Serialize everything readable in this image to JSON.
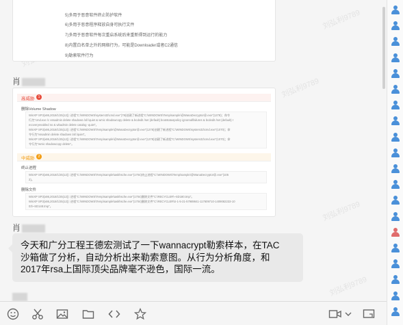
{
  "card1_steps": [
    "5)多用于恶意软件终止防护软件",
    "6)多用于恶意程序释放自身可执行文件",
    "7)多用于恶意软件每次重启系统后来重新得到运行的能力",
    "8)内置白名单之外的网络行为，可能是Downloader或者C2通信",
    "9)勒索软件行为"
  ],
  "message2": {
    "sender_name": "肖",
    "report": {
      "high": {
        "label": "高威胁",
        "count": "1",
        "category": "删除Volume Shadow",
        "details": [
          "WinXP SP3(x86,2018/1/25(12)): 进程\"C:\\WINDOWS\\system32\\cmd.exe\"(79)创建了新进程\"C:\\WINDOWS\\Temp\\sample\\@WanaDecryptor@.exe\"(1278)；命令",
          "行为\"cmd.exe /c vssadmin delete shadows /all /quiet & wmic shadowcopy delete & bcdedit /set {default} bootstatuspolicy ignoreallfailures & bcdedit /set {default} r",
          "ecoveryenabled no & wbadmin delete catalog -quiet\"。",
          "WinXP SP3(x86,2018/1/25(12)): 进程\"C:\\WINDOWS\\Temp\\sample\\@WanaDecryptor@.exe\"(1278)创建了新进程\"C:\\WINDOWS\\system32\\cmd.exe\"(1070)；命",
          "令行为\"vssadmin delete shadows /all /quiet\"。",
          "WinXP SP3(x86,2018/1/25(12)): 进程\"C:\\WINDOWS\\Temp\\sample\\@WanaDecryptor@.exe\"(1278)创建了新进程\"C:\\WINDOWS\\system32\\cmd.exe\"(1070)；命",
          "令行为\"wmic shadowcopy delete\"。"
        ]
      },
      "medium": {
        "label": "中威胁",
        "count": "2",
        "cat1": "终止进程",
        "cat1_details": [
          "WinXP SP3(x86,2018/1/25(12)): 进程\"C:\\WINDOWS\\Temp\\sample\\taskhsche.exe\"(1704)终止进程\"C:\\WINDOWS\\Temp\\sample\\@WanaDecryptor@.exe\"(105",
          "2)。"
        ],
        "cat2": "删除文件",
        "cat2_details": [
          "WinXP SP3(x86,2018/1/25(12)): 进程\"C:\\WINDOWS\\Temp\\sample\\taskhsche.exe\"(1704)删除文件\"C:\\RECYCLER\\~SD180.tmp\"。",
          "WinXP SP3(x86,2018/1/25(12)): 进程\"C:\\WINDOWS\\Temp\\sample\\taskhsche.exe\"(1704)删除文件\"C:\\RECYCLER\\S-1-5-21-57989841-117609710-1409082233-10",
          "03\\~SD148.tmp\"。"
        ]
      }
    }
  },
  "message3": {
    "sender_name": "肖",
    "text_lines": [
      "今天和广分工程王德宏测试了一下wannacrypt勒索样本，在TAC",
      "沙箱做了分析，自动分析出来勒索意图。从行为分析角度，和",
      "2017年rsa上国际顶尖品牌毫不逊色，国际一流。"
    ]
  },
  "watermark_text": "刘弘利9789",
  "toolbar": {
    "icons": [
      "emoji-icon",
      "scissors-icon",
      "image-icon",
      "folder-icon",
      "code-icon",
      "star-icon"
    ],
    "right_icons": [
      "video-icon",
      "chevron-down-icon",
      "screen-share-icon"
    ]
  },
  "colors": {
    "high": "#e74c3c",
    "medium": "#f39c12",
    "member_blue": "#4a90d9",
    "member_red": "#e06c6c",
    "bubble": "#e9e9e9"
  }
}
